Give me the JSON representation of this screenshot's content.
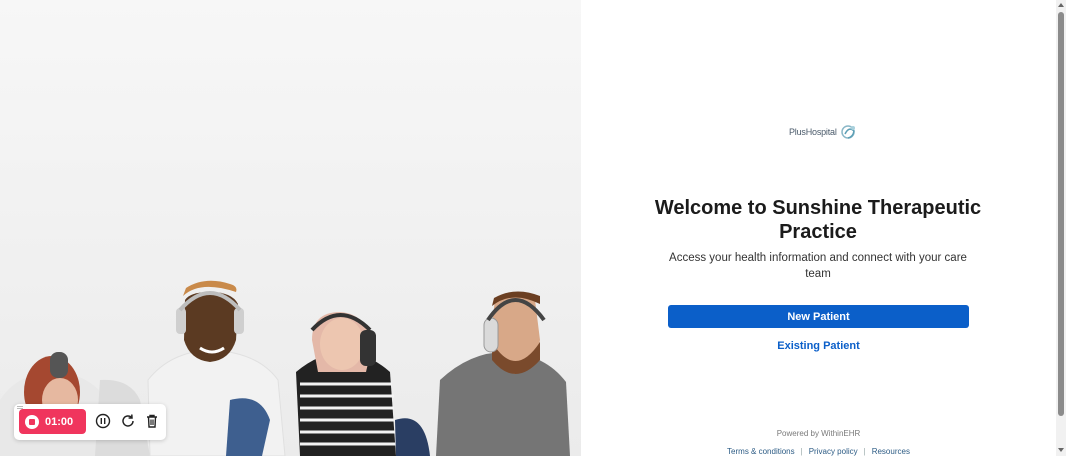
{
  "hero": {
    "image": "people-with-headphones-photo"
  },
  "brand": {
    "logo_text": "PlusHospital",
    "logo_icon": "hospital-logo-icon"
  },
  "welcome": {
    "title": "Welcome to Sunshine Therapeutic Practice",
    "subtitle": "Access your health information and connect with your care team"
  },
  "actions": {
    "new_patient": "New Patient",
    "existing_patient": "Existing Patient"
  },
  "footer": {
    "powered_by": "Powered by WithinEHR",
    "links": [
      "Terms & conditions",
      "Privacy policy",
      "Resources"
    ],
    "separator": "|"
  },
  "recorder": {
    "time": "01:00",
    "icons": [
      "stop-icon",
      "pause-icon",
      "restart-icon",
      "trash-icon"
    ]
  },
  "colors": {
    "primary": "#0b5fc9",
    "recorder_accent": "#f0355d",
    "link": "#2d5c85"
  }
}
